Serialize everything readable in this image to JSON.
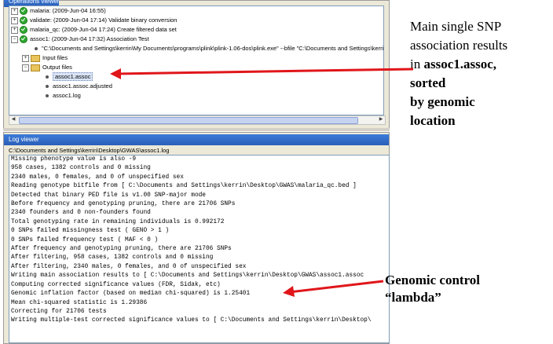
{
  "operations_viewer": {
    "title": "Operations viewer",
    "items": [
      {
        "label": "malaria: (2009-Jun-04 16:55)"
      },
      {
        "label": "validate: (2009-Jun-04 17:14) Validate binary conversion"
      },
      {
        "label": "malaria_qc: (2009-Jun-04 17:24) Create filtered data set"
      },
      {
        "label": "assoc1: (2009-Jun-04 17:32) Association Test"
      }
    ],
    "command": "\"C:\\Documents and Settings\\kerrin\\My Documents\\programs\\plink\\plink-1.06-dos\\plink.exe\"   --bfile \"C:\\Documents and Settings\\kerri",
    "input_files_label": "Input files",
    "output_files_label": "Output files",
    "output_files": [
      "assoc1.assoc",
      "assoc1.assoc.adjusted",
      "assoc1.log"
    ],
    "selected_file": "assoc1.assoc"
  },
  "log_viewer": {
    "title": "Log viewer",
    "path": "C:\\Documents and Settings\\kerrin\\Desktop\\GWAS\\assoc1.log",
    "lines": [
      "Missing phenotype value is also -9",
      "958 cases, 1382 controls and 0 missing",
      "2340 males, 0 females, and 0 of unspecified sex",
      "Reading genotype bitfile from [ C:\\Documents and Settings\\kerrin\\Desktop\\GWAS\\malaria_qc.bed ]",
      "Detected that binary PED file is v1.00 SNP-major mode",
      "Before frequency and genotyping pruning, there are 21706 SNPs",
      "2340 founders and 0 non-founders found",
      "Total genotyping rate in remaining individuals is 0.992172",
      "0 SNPs failed missingness test ( GENO > 1 )",
      "0 SNPs failed frequency test ( MAF < 0 )",
      "After frequency and genotyping pruning, there are 21706 SNPs",
      "After filtering, 958 cases, 1382 controls and 0 missing",
      "After filtering, 2340 males, 0 females, and 0 of unspecified sex",
      "Writing main association results to [ C:\\Documents and Settings\\kerrin\\Desktop\\GWAS\\assoc1.assoc",
      "Computing corrected significance values (FDR, Sidak, etc)",
      "Genomic inflation factor (based on median chi-squared) is 1.25401",
      "Mean chi-squared statistic is 1.29386",
      "Correcting for 21706 tests",
      "Writing multiple-test corrected significance values to [ C:\\Documents and Settings\\kerrin\\Desktop\\"
    ]
  },
  "annotations": {
    "main_result": {
      "line1": "Main single SNP",
      "line2": "association results",
      "line3_prefix": "in ",
      "line3_bold": "assoc1.assoc,",
      "line4": "sorted",
      "line5": "by genomic",
      "line6": "location"
    },
    "genomic_control": {
      "line1": "Genomic control",
      "line2": "“lambda”"
    }
  },
  "colors": {
    "arrow": "#e0161a",
    "status_ok": "#2fa82f",
    "title_bar": "#2a5fb8"
  },
  "icons": [
    "expand-icon",
    "collapse-icon",
    "status-ok-icon",
    "folder-icon",
    "file-dot-icon"
  ]
}
